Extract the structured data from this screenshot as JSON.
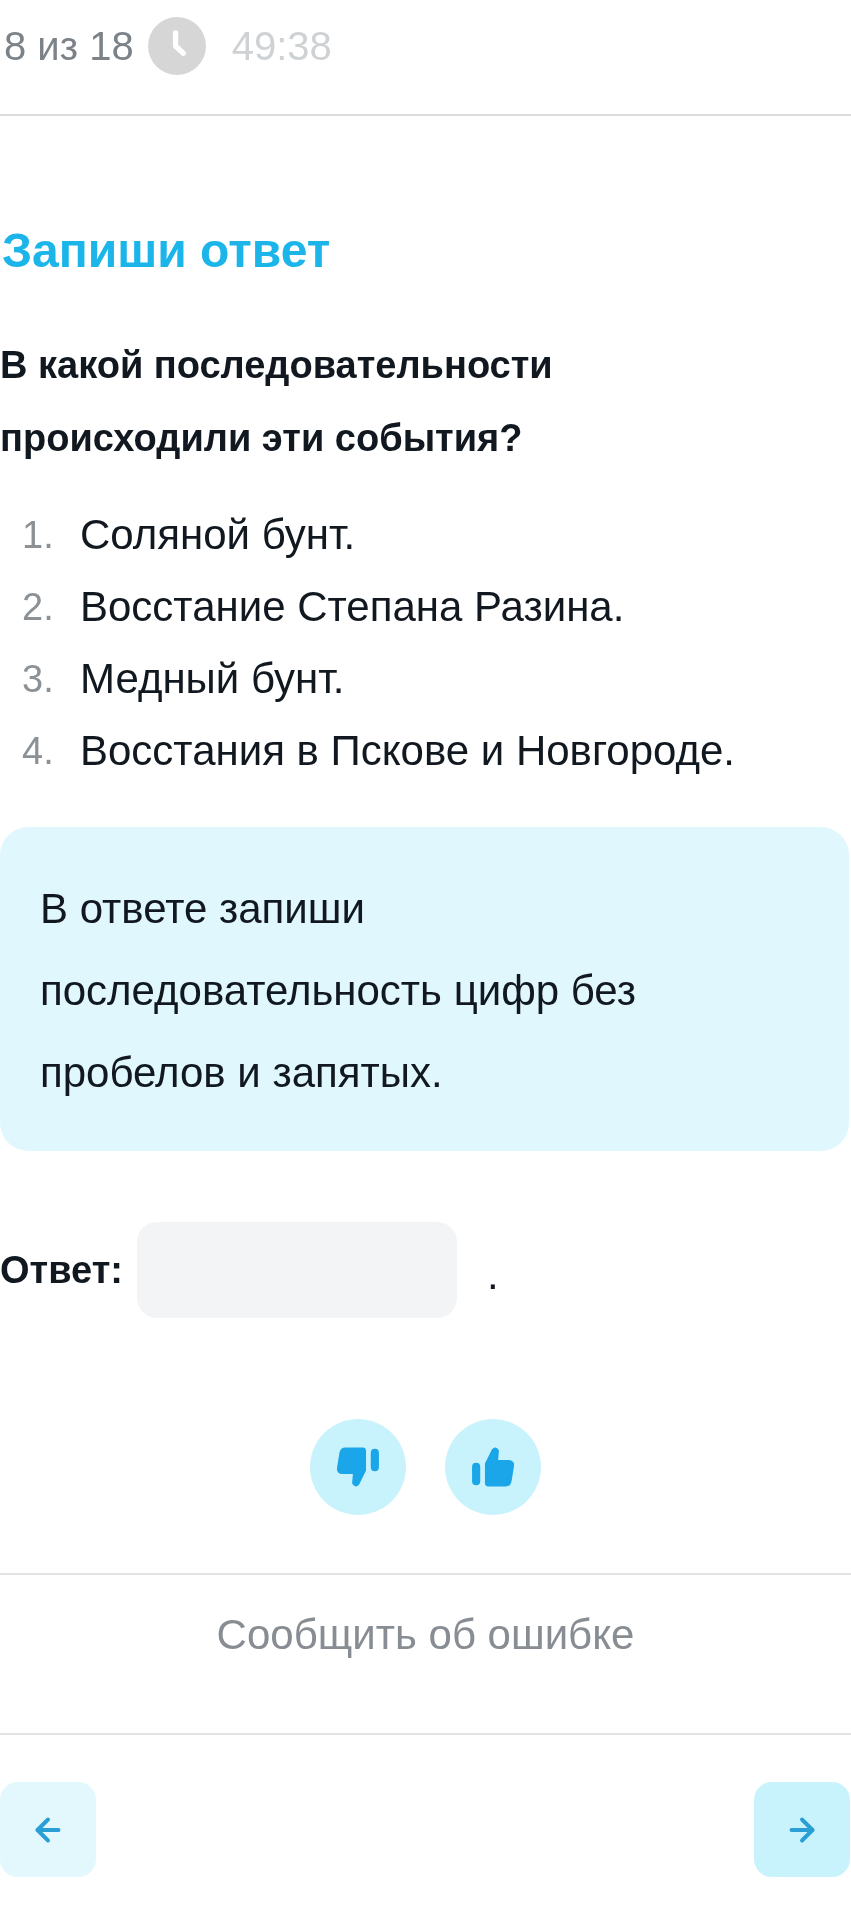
{
  "header": {
    "progress": "8 из 18",
    "timer": "49:38"
  },
  "task": {
    "title": "Запиши ответ",
    "question": "В какой последовательности происходили эти события?",
    "items": [
      {
        "number": "1.",
        "text": "Соляной бунт."
      },
      {
        "number": "2.",
        "text": "Восстание Степана Разина."
      },
      {
        "number": "3.",
        "text": "Медный бунт."
      },
      {
        "number": "4.",
        "text": "Восстания в Пскове и Новгороде."
      }
    ]
  },
  "hint": "В ответе запиши последовательность цифр без пробелов и запятых.",
  "answer": {
    "label": "Ответ:",
    "suffix": "."
  },
  "report_link": "Сообщить об ошибке"
}
